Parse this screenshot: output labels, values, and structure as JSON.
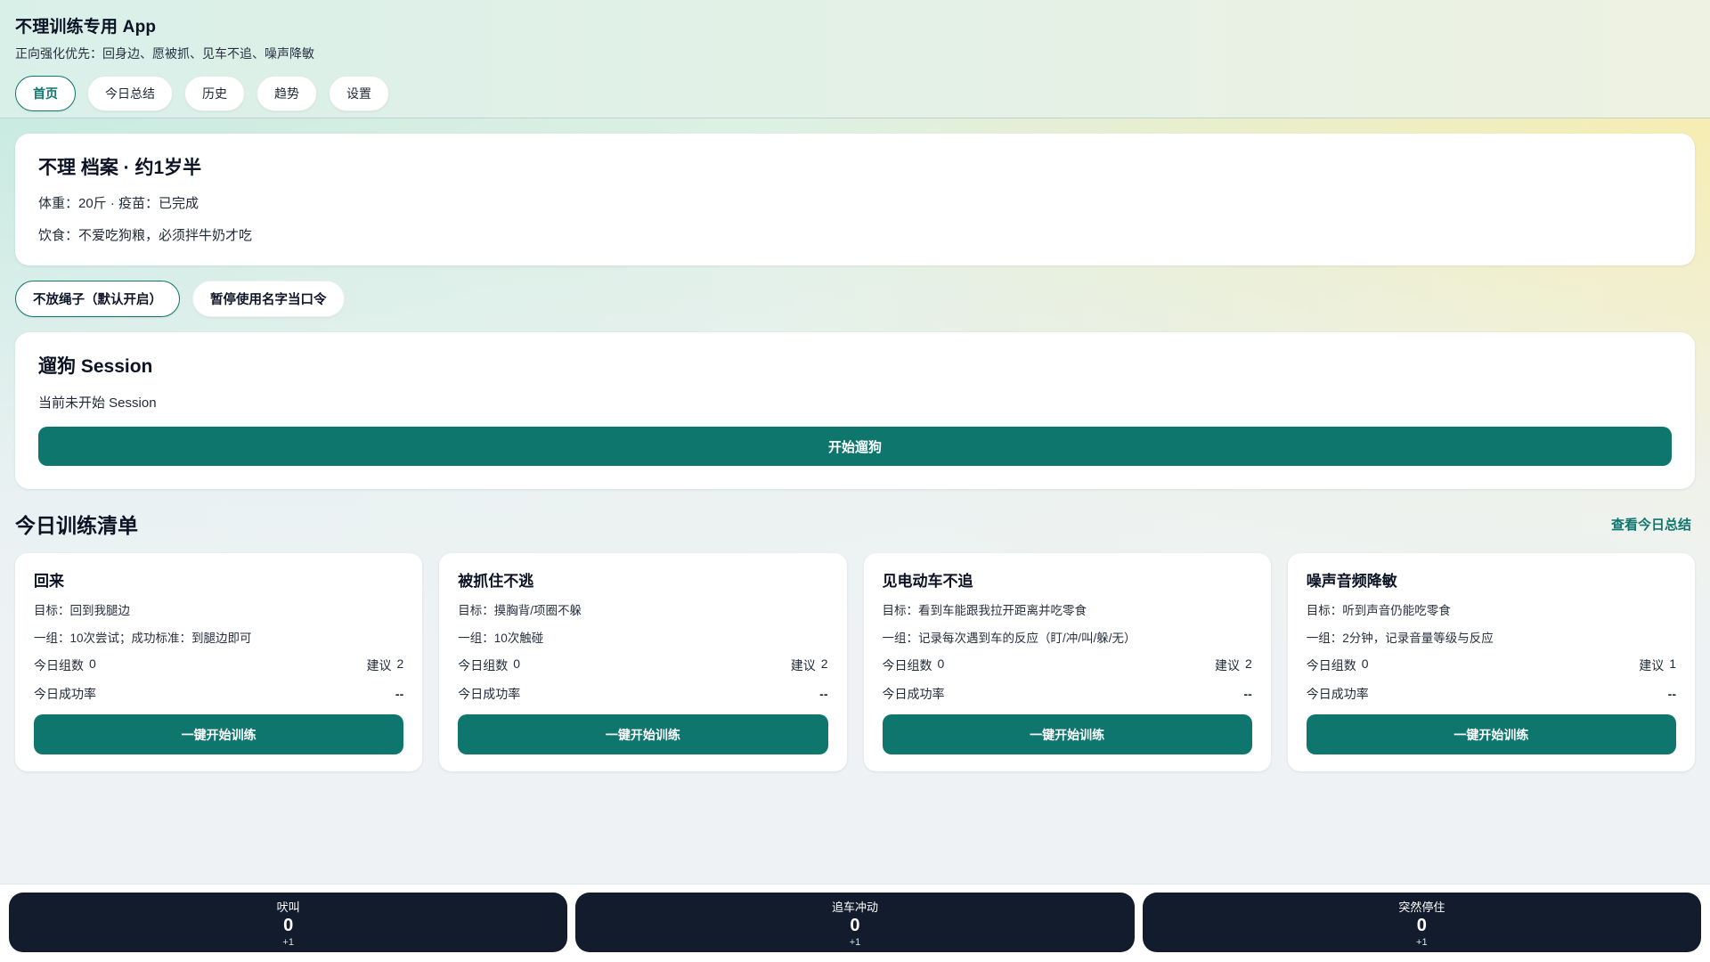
{
  "header": {
    "title": "不理训练专用 App",
    "subtitle": "正向强化优先：回身边、愿被抓、见车不追、噪声降敏",
    "nav": [
      {
        "label": "首页",
        "active": true
      },
      {
        "label": "今日总结",
        "active": false
      },
      {
        "label": "历史",
        "active": false
      },
      {
        "label": "趋势",
        "active": false
      },
      {
        "label": "设置",
        "active": false
      }
    ]
  },
  "profile": {
    "title": "不理 档案 · 约1岁半",
    "line1": "体重：20斤 · 疫苗：已完成",
    "line2": "饮食：不爱吃狗粮，必须拌牛奶才吃"
  },
  "toggles": [
    {
      "label": "不放绳子（默认开启）",
      "active": true
    },
    {
      "label": "暂停使用名字当口令",
      "active": false
    }
  ],
  "session": {
    "title": "遛狗 Session",
    "status": "当前未开始 Session",
    "start_button": "开始遛狗"
  },
  "today": {
    "title": "今日训练清单",
    "link": "查看今日总结",
    "cards": [
      {
        "title": "回来",
        "goal": "目标：回到我腿边",
        "set": "一组：10次尝试；成功标准：到腿边即可",
        "sets_label": "今日组数",
        "sets_value": "0",
        "suggest_label": "建议",
        "suggest_value": "2",
        "rate_label": "今日成功率",
        "rate_value": "--",
        "button": "一键开始训练"
      },
      {
        "title": "被抓住不逃",
        "goal": "目标：摸胸背/项圈不躲",
        "set": "一组：10次触碰",
        "sets_label": "今日组数",
        "sets_value": "0",
        "suggest_label": "建议",
        "suggest_value": "2",
        "rate_label": "今日成功率",
        "rate_value": "--",
        "button": "一键开始训练"
      },
      {
        "title": "见电动车不追",
        "goal": "目标：看到车能跟我拉开距离并吃零食",
        "set": "一组：记录每次遇到车的反应（盯/冲/叫/躲/无）",
        "sets_label": "今日组数",
        "sets_value": "0",
        "suggest_label": "建议",
        "suggest_value": "2",
        "rate_label": "今日成功率",
        "rate_value": "--",
        "button": "一键开始训练"
      },
      {
        "title": "噪声音频降敏",
        "goal": "目标：听到声音仍能吃零食",
        "set": "一组：2分钟，记录音量等级与反应",
        "sets_label": "今日组数",
        "sets_value": "0",
        "suggest_label": "建议",
        "suggest_value": "1",
        "rate_label": "今日成功率",
        "rate_value": "--",
        "button": "一键开始训练"
      }
    ]
  },
  "counters": [
    {
      "label": "吠叫",
      "count": "0",
      "increment": "+1"
    },
    {
      "label": "追车冲动",
      "count": "0",
      "increment": "+1"
    },
    {
      "label": "突然停住",
      "count": "0",
      "increment": "+1"
    }
  ],
  "colors": {
    "primary_teal": "#0f766e",
    "counter_dark": "#131c2d",
    "bg_mint": "#c9ebe1",
    "bg_yellow": "#f6edb2",
    "bg_bottom_gray": "#eef2f4"
  }
}
